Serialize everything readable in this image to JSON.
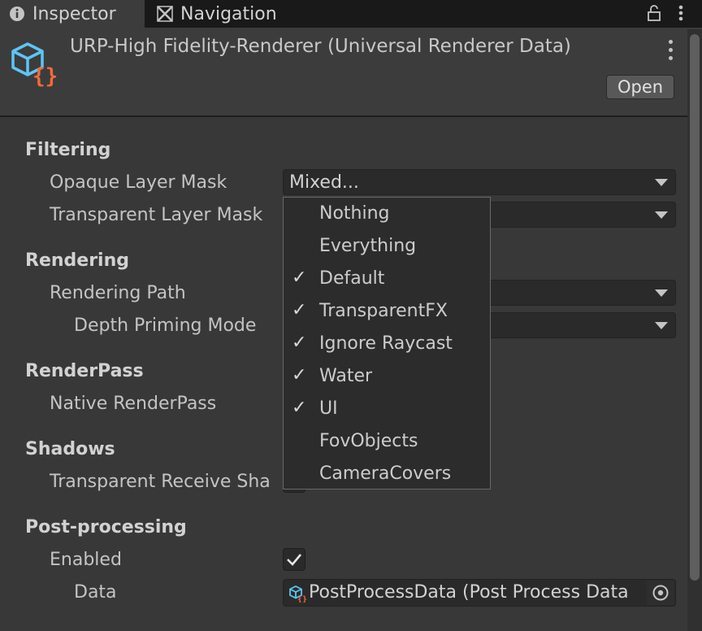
{
  "tabs": [
    {
      "label": "Inspector",
      "icon": "info-icon"
    },
    {
      "label": "Navigation",
      "icon": "navmesh-icon"
    }
  ],
  "tabbar_icons": [
    "lock-icon",
    "kebab-menu-icon"
  ],
  "header": {
    "title": "URP-High Fidelity-Renderer (Universal Renderer Data)",
    "open_label": "Open",
    "asset_icon": "scriptable-object-icon"
  },
  "sections": {
    "filtering": "Filtering",
    "rendering": "Rendering",
    "renderpass": "RenderPass",
    "shadows": "Shadows",
    "postprocessing": "Post-processing"
  },
  "fields": {
    "opaque_layer_mask": {
      "label": "Opaque Layer Mask",
      "value": "Mixed..."
    },
    "transparent_layer_mask": {
      "label": "Transparent Layer Mask"
    },
    "rendering_path": {
      "label": "Rendering Path"
    },
    "depth_priming_mode": {
      "label": "Depth Priming Mode"
    },
    "native_renderpass": {
      "label": "Native RenderPass"
    },
    "transparent_receive_shadows": {
      "label": "Transparent Receive Sha"
    },
    "pp_enabled": {
      "label": "Enabled",
      "checked": true
    },
    "pp_data": {
      "label": "Data",
      "value": "PostProcessData (Post Process Data"
    }
  },
  "layer_dropdown": {
    "options": [
      {
        "label": "Nothing",
        "checked": false
      },
      {
        "label": "Everything",
        "checked": false
      },
      {
        "label": "Default",
        "checked": true
      },
      {
        "label": "TransparentFX",
        "checked": true
      },
      {
        "label": "Ignore Raycast",
        "checked": true
      },
      {
        "label": "Water",
        "checked": true
      },
      {
        "label": "UI",
        "checked": true
      },
      {
        "label": "FovObjects",
        "checked": false
      },
      {
        "label": "CameraCovers",
        "checked": false
      }
    ],
    "check_glyph": "✓"
  },
  "colors": {
    "accent_orange": "#f06a3c",
    "asset_blue": "#5cc6f5"
  }
}
